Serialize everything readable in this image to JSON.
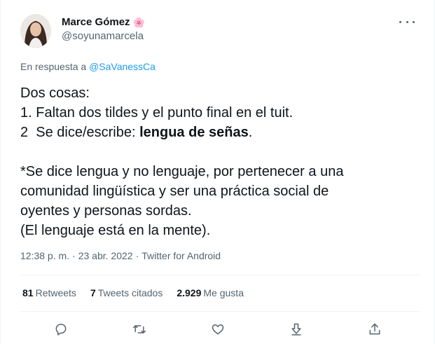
{
  "author": {
    "display_name": "Marce Gómez",
    "emoji": "🌸",
    "handle": "@soyunamarcela"
  },
  "reply": {
    "prefix": "En respuesta a",
    "mention": "@SaVanessCa"
  },
  "tweet": {
    "line1": "Dos cosas:",
    "line2": "1. Faltan dos tildes y el punto final en el tuit.",
    "line3_prefix": "2  Se dice/escribe: ",
    "line3_bold": "lengua de señas",
    "line3_suffix": ".",
    "line4": "*Se dice lengua y no lenguaje, por pertenecer a una",
    "line5": "comunidad lingüística y ser una práctica social de",
    "line6": "oyentes y personas sordas.",
    "line7": "(El lenguaje está en la mente)."
  },
  "meta": {
    "time": "12:38 p. m.",
    "sep1": "·",
    "date": "23 abr. 2022",
    "sep2": "·",
    "source": "Twitter for Android"
  },
  "stats": {
    "retweets_count": "81",
    "retweets_label": "Retweets",
    "quotes_count": "7",
    "quotes_label": "Tweets citados",
    "likes_count": "2.929",
    "likes_label": "Me gusta"
  },
  "icons": {
    "reply": "reply-icon",
    "retweet": "retweet-icon",
    "like": "heart-icon",
    "bookmark": "bookmark-icon",
    "share": "share-icon",
    "more": "more-icon"
  },
  "colors": {
    "text_primary": "#0f1419",
    "text_secondary": "#536471",
    "accent": "#1d9bf0",
    "divider": "#eff3f4"
  }
}
